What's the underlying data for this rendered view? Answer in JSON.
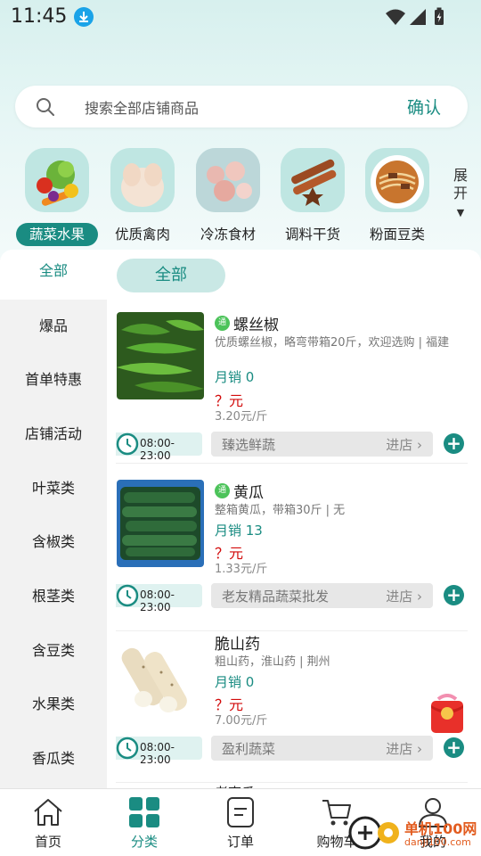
{
  "status_bar": {
    "time": "11:45"
  },
  "search": {
    "placeholder": "搜索全部店铺商品",
    "confirm_label": "确认"
  },
  "categories": [
    {
      "label": "蔬菜水果",
      "icon": "vegetables-fruits-icon",
      "active": true
    },
    {
      "label": "优质禽肉",
      "icon": "poultry-icon",
      "active": false
    },
    {
      "label": "冷冻食材",
      "icon": "frozen-food-icon",
      "active": false
    },
    {
      "label": "调料干货",
      "icon": "spices-icon",
      "active": false
    },
    {
      "label": "粉面豆类",
      "icon": "noodles-icon",
      "active": false
    }
  ],
  "expand_label": "展开",
  "left_nav": {
    "all_label": "全部",
    "items": [
      "爆品",
      "首单特惠",
      "店铺活动",
      "叶菜类",
      "含椒类",
      "根茎类",
      "含豆类",
      "水果类",
      "香瓜类"
    ]
  },
  "sub_filter": {
    "all_label": "全部"
  },
  "products": [
    {
      "tag": "通",
      "name": "螺丝椒",
      "desc": "优质螺丝椒，略弯带箱20斤，欢迎选购 | 福建",
      "sales": "月销 0",
      "price": "？元",
      "unit_price": "3.20元/斤",
      "hours": "08:00-23:00",
      "shop": "臻选鲜蔬",
      "enter": "进店 ›"
    },
    {
      "tag": "通",
      "name": "黄瓜",
      "desc": "整箱黄瓜，带箱30斤 | 无",
      "sales": "月销 13",
      "price": "？元",
      "unit_price": "1.33元/斤",
      "hours": "08:00-23:00",
      "shop": "老友精品蔬菜批发",
      "enter": "进店 ›"
    },
    {
      "tag": "",
      "name": "脆山药",
      "desc": "粗山药，淮山药 | 荆州",
      "sales": "月销 0",
      "price": "？元",
      "unit_price": "7.00元/斤",
      "hours": "08:00-23:00",
      "shop": "盈利蔬菜",
      "enter": "进店 ›"
    }
  ],
  "partial_next_product": "老南瓜",
  "tabs": [
    {
      "label": "首页",
      "icon": "home-icon",
      "active": false
    },
    {
      "label": "分类",
      "icon": "category-grid-icon",
      "active": true
    },
    {
      "label": "订单",
      "icon": "order-icon",
      "active": false
    },
    {
      "label": "购物车",
      "icon": "cart-icon",
      "active": false
    },
    {
      "label": "我的",
      "icon": "profile-icon",
      "active": false
    }
  ],
  "watermark": {
    "text": "单机100网",
    "sub": "danji100.com"
  },
  "colors": {
    "accent": "#1a8c82",
    "price_red": "#d20b0b",
    "tag_green": "#4cc35a"
  }
}
